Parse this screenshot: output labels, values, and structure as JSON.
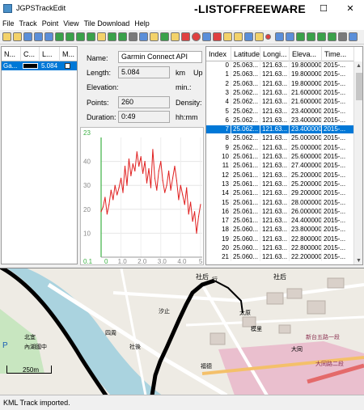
{
  "window": {
    "title": "JGPSTrackEdit",
    "watermark": "-LISTOFFREEWARE",
    "minimize": "—",
    "maximize": "☐",
    "close": "✕"
  },
  "menu": [
    "File",
    "Track",
    "Point",
    "View",
    "Tile Download",
    "Help"
  ],
  "track_list": {
    "columns": [
      "N...",
      "C...",
      "L...",
      "M..."
    ],
    "rows": [
      {
        "name": "Ga...",
        "color": "#000000",
        "length": "5.084"
      }
    ]
  },
  "info": {
    "name_label": "Name:",
    "name_value": "Garmin Connect API",
    "length_label": "Length:",
    "length_value": "5.084",
    "length_unit": "km",
    "up_label": "Up",
    "elevation_label": "Elevation:",
    "min_label": "min.:",
    "points_label": "Points:",
    "points_value": "260",
    "density_label": "Density:",
    "duration_label": "Duration:",
    "duration_value": "0:49",
    "duration_unit": "hh:mm"
  },
  "chart_data": {
    "type": "line",
    "y_top_label": "23",
    "y_ticks": [
      "40",
      "30",
      "20",
      "10"
    ],
    "x_ticks": [
      "0.1",
      "0",
      "1.0",
      "2.0",
      "3.0",
      "4.0",
      "5"
    ],
    "xlim": [
      0,
      5.084
    ],
    "ylim": [
      0,
      50
    ],
    "series_color": "#e02020",
    "x": [
      0.0,
      0.1,
      0.2,
      0.3,
      0.4,
      0.5,
      0.6,
      0.7,
      0.8,
      0.9,
      1.0,
      1.1,
      1.2,
      1.3,
      1.4,
      1.5,
      1.6,
      1.7,
      1.8,
      1.9,
      2.0,
      2.1,
      2.2,
      2.3,
      2.4,
      2.5,
      2.6,
      2.7,
      2.8,
      2.9,
      3.0,
      3.1,
      3.2,
      3.3,
      3.4,
      3.5,
      3.6,
      3.7,
      3.8,
      3.9,
      4.0,
      4.1,
      4.2,
      4.3,
      4.4,
      4.5,
      4.6,
      4.7,
      4.8,
      4.9,
      5.0
    ],
    "y": [
      19,
      21,
      25,
      18,
      22,
      28,
      24,
      30,
      26,
      29,
      33,
      27,
      38,
      30,
      41,
      34,
      39,
      36,
      44,
      38,
      42,
      35,
      40,
      31,
      37,
      29,
      45,
      33,
      28,
      36,
      40,
      32,
      27,
      30,
      36,
      28,
      33,
      38,
      32,
      24,
      30,
      26,
      22,
      29,
      18,
      23,
      15,
      19,
      10,
      17,
      22
    ]
  },
  "points_table": {
    "columns": [
      "Index",
      "Latitude",
      "Longi...",
      "Eleva...",
      "Time..."
    ],
    "rows": [
      [
        "0",
        "25.063...",
        "121.63...",
        "19.800000",
        "2015-..."
      ],
      [
        "1",
        "25.063...",
        "121.63...",
        "19.800000",
        "2015-..."
      ],
      [
        "2",
        "25.063...",
        "121.63...",
        "19.800000",
        "2015-..."
      ],
      [
        "3",
        "25.062...",
        "121.63...",
        "21.600000",
        "2015-..."
      ],
      [
        "4",
        "25.062...",
        "121.63...",
        "21.600000",
        "2015-..."
      ],
      [
        "5",
        "25.062...",
        "121.63...",
        "23.400000",
        "2015-..."
      ],
      [
        "6",
        "25.062...",
        "121.63...",
        "23.400000",
        "2015-..."
      ],
      [
        "7",
        "25.062...",
        "121.63...",
        "23.400000",
        "2015-..."
      ],
      [
        "8",
        "25.062...",
        "121.63...",
        "25.000000",
        "2015-..."
      ],
      [
        "9",
        "25.062...",
        "121.63...",
        "25.000000",
        "2015-..."
      ],
      [
        "10",
        "25.061...",
        "121.63...",
        "25.600000",
        "2015-..."
      ],
      [
        "11",
        "25.061...",
        "121.63...",
        "27.400000",
        "2015-..."
      ],
      [
        "12",
        "25.061...",
        "121.63...",
        "25.200000",
        "2015-..."
      ],
      [
        "13",
        "25.061...",
        "121.63...",
        "25.200000",
        "2015-..."
      ],
      [
        "14",
        "25.061...",
        "121.63...",
        "29.200000",
        "2015-..."
      ],
      [
        "15",
        "25.061...",
        "121.63...",
        "28.000000",
        "2015-..."
      ],
      [
        "16",
        "25.061...",
        "121.63...",
        "26.000000",
        "2015-..."
      ],
      [
        "17",
        "25.061...",
        "121.63...",
        "24.400000",
        "2015-..."
      ],
      [
        "18",
        "25.060...",
        "121.63...",
        "23.800000",
        "2015-..."
      ],
      [
        "19",
        "25.060...",
        "121.63...",
        "22.800000",
        "2015-..."
      ],
      [
        "20",
        "25.060...",
        "121.63...",
        "22.800000",
        "2015-..."
      ],
      [
        "21",
        "25.060...",
        "121.63...",
        "22.200000",
        "2015-..."
      ]
    ],
    "selected_index": 7
  },
  "map": {
    "scale_label": "250m",
    "labels": [
      "社后",
      "行",
      "社后",
      "太原",
      "大同",
      "新台五路一段",
      "汐止",
      "北宜",
      "四周",
      "內湖國中",
      "社後",
      "模里",
      "大同路二段",
      "福德",
      "P"
    ]
  },
  "status": {
    "message": "KML Track imported."
  }
}
